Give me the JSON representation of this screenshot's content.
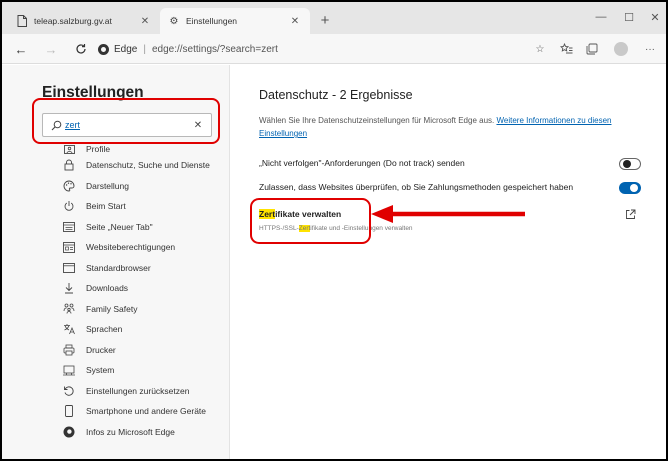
{
  "browser": {
    "tabs": [
      {
        "label": "teleap.salzburg.gv.at",
        "icon": "page-icon",
        "active": false
      },
      {
        "label": "Einstellungen",
        "icon": "gear-icon",
        "active": true
      }
    ],
    "address": {
      "brand": "Edge",
      "separator": "|",
      "url": "edge://settings/?search=zert"
    },
    "toolbar_icons": [
      "star-icon",
      "favorites-icon",
      "collections-icon",
      "avatar",
      "more-icon"
    ]
  },
  "settings": {
    "title": "Einstellungen",
    "search": {
      "value": "zert",
      "placeholder": ""
    },
    "menu": [
      {
        "label": "Profile",
        "icon": "person-icon"
      },
      {
        "label": "Datenschutz, Suche und Dienste",
        "icon": "lock-icon"
      },
      {
        "label": "Darstellung",
        "icon": "palette-icon"
      },
      {
        "label": "Beim Start",
        "icon": "power-icon"
      },
      {
        "label": "Seite „Neuer Tab\"",
        "icon": "newtab-page-icon"
      },
      {
        "label": "Websiteberechtigungen",
        "icon": "site-permissions-icon"
      },
      {
        "label": "Standardbrowser",
        "icon": "browser-icon"
      },
      {
        "label": "Downloads",
        "icon": "download-icon"
      },
      {
        "label": "Family Safety",
        "icon": "family-icon"
      },
      {
        "label": "Sprachen",
        "icon": "language-icon"
      },
      {
        "label": "Drucker",
        "icon": "printer-icon"
      },
      {
        "label": "System",
        "icon": "system-icon"
      },
      {
        "label": "Einstellungen zurücksetzen",
        "icon": "reset-icon"
      },
      {
        "label": "Smartphone und andere Geräte",
        "icon": "phone-icon"
      },
      {
        "label": "Infos zu Microsoft Edge",
        "icon": "edge-icon"
      }
    ]
  },
  "results": {
    "title": "Datenschutz - 2 Ergebnisse",
    "description": "Wählen Sie Ihre Datenschutzeinstellungen für Microsoft Edge aus. ",
    "description_link": "Weitere Informationen zu diesen Einstellungen",
    "dnt_label": "„Nicht verfolgen\"-Anforderungen (Do not track) senden",
    "dnt_enabled": false,
    "payment_label": "Zulassen, dass Websites überprüfen, ob Sie Zahlungsmethoden gespeichert haben",
    "payment_enabled": true,
    "cert": {
      "title_highlight": "Zert",
      "title_rest": "ifikate verwalten",
      "sub_prefix": "HTTPS-/SSL-",
      "sub_highlight": "Zert",
      "sub_rest": "ifikate und -Einstellungen verwalten"
    }
  },
  "annotation": {
    "color": "#e00000"
  },
  "colors": {
    "accent": "#0063b1",
    "highlight": "#ffe300"
  }
}
